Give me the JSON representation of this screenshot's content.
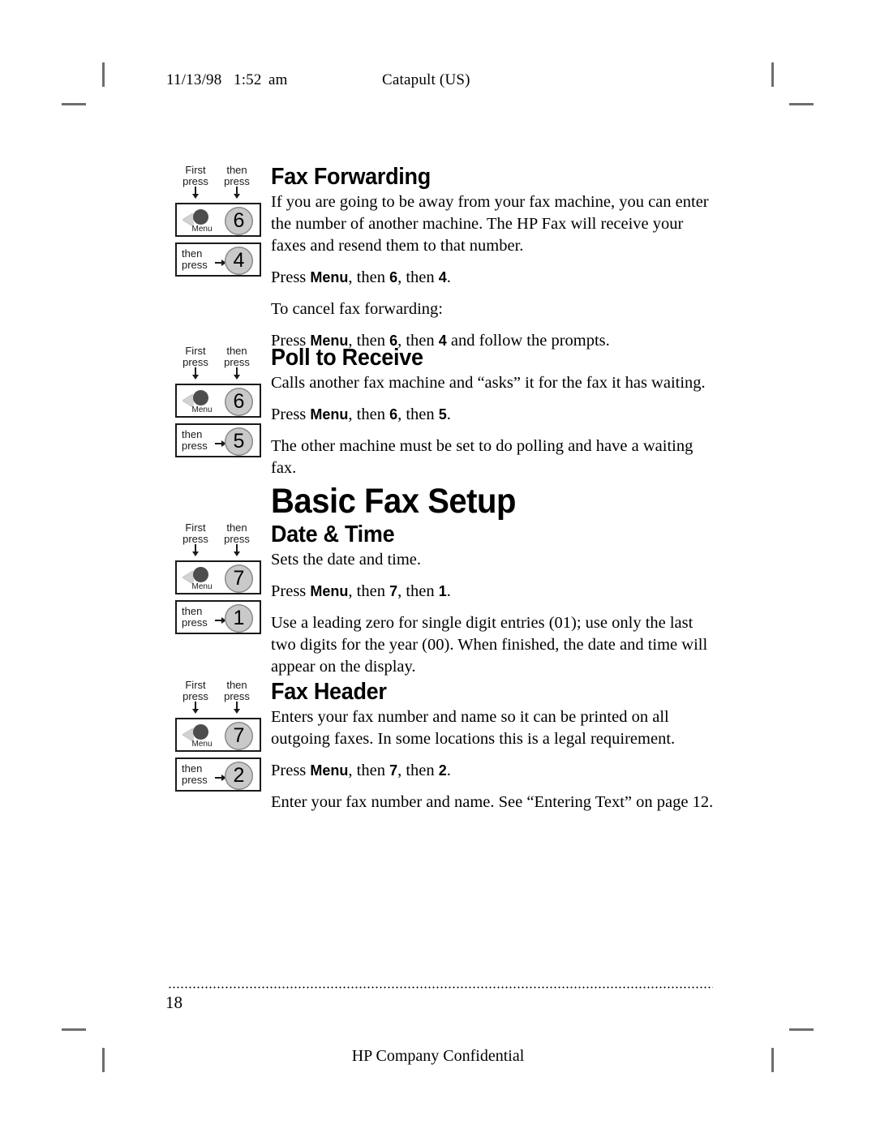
{
  "header": {
    "date": "11/13/98",
    "time": "1:52",
    "ampm": "am",
    "project": "Catapult (US)"
  },
  "labels": {
    "first_press_line1": "First",
    "first_press_line2": "press",
    "then_press_line1": "then",
    "then_press_line2": "press",
    "menu_caption": "Menu"
  },
  "sections": [
    {
      "id": "fax-forwarding",
      "heading": "Fax Forwarding",
      "keys": {
        "menu": "Menu",
        "first": "6",
        "second": "4"
      },
      "paragraphs": [
        {
          "type": "plain",
          "text": "If you are going to be away from your fax machine, you can enter the number of another machine. The HP Fax will receive your faxes and resend them to that number."
        },
        {
          "type": "press",
          "pre": "Press ",
          "key1": "Menu",
          "mid1": ", then ",
          "key2": "6",
          "mid2": ", then ",
          "key3": "4",
          "post": "."
        },
        {
          "type": "plain",
          "text": "To cancel fax forwarding:"
        },
        {
          "type": "press",
          "pre": "Press ",
          "key1": "Menu",
          "mid1": ", then ",
          "key2": "6",
          "mid2": ", then ",
          "key3": "4",
          "post": " and follow the prompts."
        }
      ]
    },
    {
      "id": "poll-to-receive",
      "heading": "Poll to Receive",
      "keys": {
        "menu": "Menu",
        "first": "6",
        "second": "5"
      },
      "paragraphs": [
        {
          "type": "plain",
          "text": "Calls another fax machine and “asks” it for the fax it has waiting."
        },
        {
          "type": "press",
          "pre": "Press ",
          "key1": "Menu",
          "mid1": ", then ",
          "key2": "6",
          "mid2": ", then ",
          "key3": "5",
          "post": "."
        },
        {
          "type": "plain",
          "text": "The other machine must be set to do polling and have a waiting fax."
        }
      ]
    },
    {
      "id": "date-and-time",
      "heading": "Date & Time",
      "keys": {
        "menu": "Menu",
        "first": "7",
        "second": "1"
      },
      "paragraphs": [
        {
          "type": "plain",
          "text": "Sets the date and time."
        },
        {
          "type": "press",
          "pre": "Press ",
          "key1": "Menu",
          "mid1": ", then ",
          "key2": "7",
          "mid2": ", then ",
          "key3": "1",
          "post": "."
        },
        {
          "type": "plain",
          "text": "Use a leading zero for single digit entries (01); use only the last two digits for the year (00). When finished, the date and time will appear on the display."
        }
      ]
    },
    {
      "id": "fax-header",
      "heading": "Fax Header",
      "keys": {
        "menu": "Menu",
        "first": "7",
        "second": "2"
      },
      "paragraphs": [
        {
          "type": "plain",
          "text": "Enters your fax number and name so it can be printed on all outgoing faxes. In some locations this is a legal requirement."
        },
        {
          "type": "press",
          "pre": "Press ",
          "key1": "Menu",
          "mid1": ", then ",
          "key2": "7",
          "mid2": ", then ",
          "key3": "2",
          "post": "."
        },
        {
          "type": "plain",
          "text": "Enter your fax number and name. See “Entering Text” on page 12."
        }
      ]
    }
  ],
  "chapter_title": "Basic Fax Setup",
  "footer": {
    "page_number": "18",
    "confidential": "HP Company Confidential"
  }
}
